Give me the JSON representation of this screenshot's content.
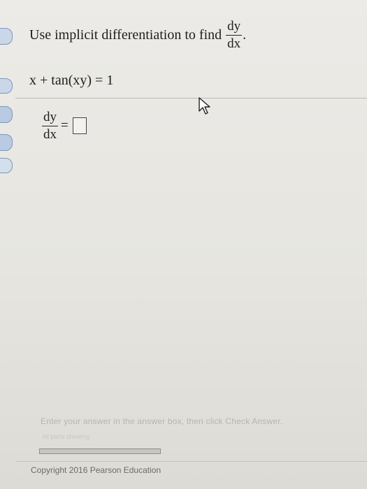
{
  "question": {
    "prompt_text": "Use implicit differentiation to find",
    "prompt_frac_num": "dy",
    "prompt_frac_den": "dx",
    "prompt_period": ".",
    "equation": "x + tan(xy) = 1"
  },
  "answer": {
    "frac_num": "dy",
    "frac_den": "dx",
    "equals": "=",
    "value": ""
  },
  "footer": {
    "instruction": "Enter your answer in the answer box, then click Check Answer.",
    "parts_label": "All parts showing",
    "parts_progress": 1.0,
    "copyright": "Copyright 2016 Pearson Education"
  }
}
